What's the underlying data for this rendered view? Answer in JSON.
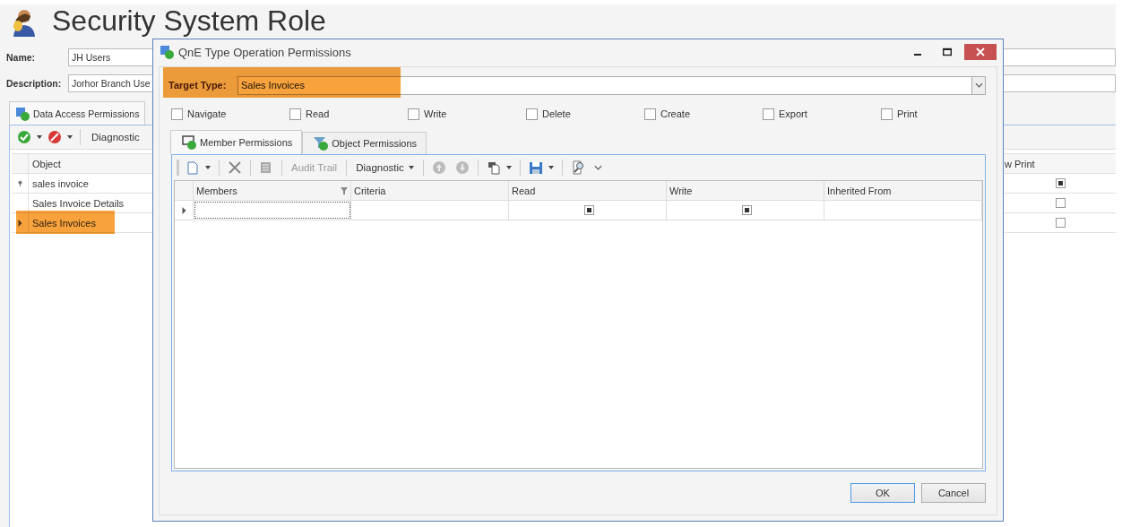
{
  "page": {
    "title": "Security System Role",
    "fields": [
      {
        "label": "Name:",
        "value": "JH Users"
      },
      {
        "label": "Description:",
        "value": "Jorhor Branch Use"
      }
    ],
    "tabs": [
      {
        "label": "Data Access Permissions",
        "selected": true
      }
    ],
    "toolbar": {
      "diagnostic": "Diagnostic"
    },
    "grid": {
      "columns": [
        "Object",
        "w Print"
      ],
      "rows": [
        {
          "object": "sales invoice",
          "print": true,
          "pinned": true,
          "selected": false,
          "highlighted": false
        },
        {
          "object": "Sales Invoice Details",
          "print": false,
          "pinned": false,
          "selected": false,
          "highlighted": false
        },
        {
          "object": "Sales Invoices",
          "print": false,
          "pinned": false,
          "selected": true,
          "highlighted": true
        }
      ]
    }
  },
  "dialog": {
    "title": "QnE Type Operation Permissions",
    "target_type": {
      "label": "Target Type:",
      "value": "Sales Invoices",
      "highlighted": true
    },
    "operations": [
      {
        "label": "Navigate",
        "checked": false
      },
      {
        "label": "Read",
        "checked": false
      },
      {
        "label": "Write",
        "checked": false
      },
      {
        "label": "Delete",
        "checked": false
      },
      {
        "label": "Create",
        "checked": false
      },
      {
        "label": "Export",
        "checked": false
      },
      {
        "label": "Print",
        "checked": false
      }
    ],
    "tabs": [
      {
        "label": "Member Permissions",
        "selected": true
      },
      {
        "label": "Object Permissions",
        "selected": false
      }
    ],
    "toolbar": {
      "audit_trail": {
        "label": "Audit Trail",
        "disabled": true
      },
      "diagnostic": "Diagnostic"
    },
    "grid": {
      "columns": [
        "Members",
        "Criteria",
        "Read",
        "Write",
        "Inherited From"
      ],
      "rows": [
        {
          "read": true,
          "write": true,
          "selected": true
        }
      ]
    },
    "buttons": [
      "OK",
      "Cancel"
    ]
  }
}
